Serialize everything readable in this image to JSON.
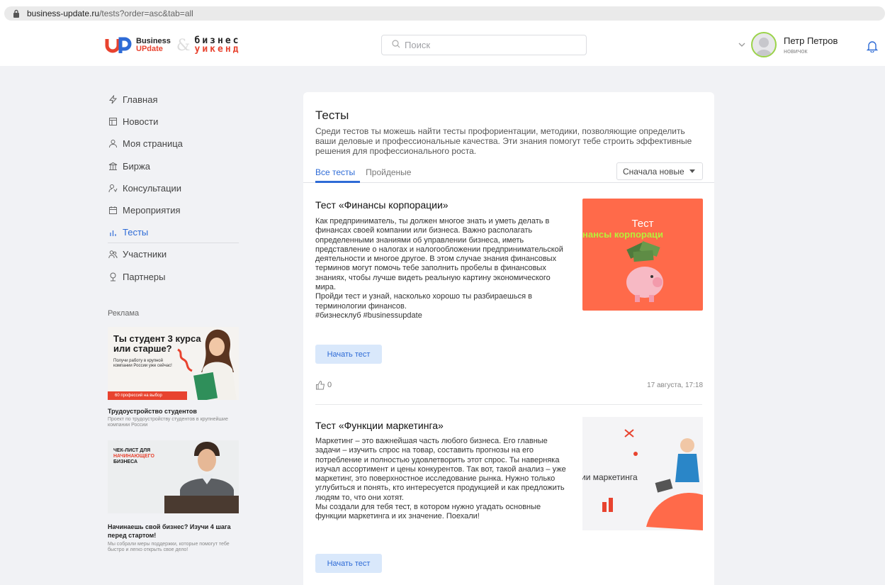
{
  "browser": {
    "url_host": "business-update.ru",
    "url_path": "/tests?order=asc&tab=all"
  },
  "header": {
    "logo": {
      "brand_top": "Business",
      "brand_bottom": "UPdate",
      "amp": "&",
      "word_top": "бизнес",
      "word_bottom": "уикенд"
    },
    "search": {
      "placeholder": "Поиск"
    },
    "user": {
      "name": "Петр Петров",
      "role": "новичок"
    }
  },
  "sidebar": {
    "items": [
      {
        "label": "Главная",
        "icon": "lightning-icon"
      },
      {
        "label": "Новости",
        "icon": "newspaper-icon"
      },
      {
        "label": "Моя страница",
        "icon": "user-icon"
      },
      {
        "label": "Биржа",
        "icon": "exchange-icon"
      },
      {
        "label": "Консультации",
        "icon": "consult-icon"
      },
      {
        "label": "Мероприятия",
        "icon": "calendar-icon"
      },
      {
        "label": "Тесты",
        "icon": "chart-icon",
        "active": true
      },
      {
        "label": "Участники",
        "icon": "users-icon"
      },
      {
        "label": "Партнеры",
        "icon": "partner-icon"
      }
    ],
    "ads_label": "Реклама",
    "ad1": {
      "headline": "Ты студент 3 курса или старше?",
      "sub": "Получи работу в крупной компании России уже сейчас!",
      "bar": "60 профессий на выбор",
      "title": "Трудоустройство студентов",
      "desc": "Проект по трудоустройству студентов в крупнейшие компании России"
    },
    "ad2": {
      "line1": "ЧЕК-ЛИСТ ДЛЯ",
      "line2": "НАЧИНАЮЩЕГО",
      "line3": "БИЗНЕСА",
      "title": "Начинаешь свой бизнес? Изучи 4 шага перед стартом!",
      "desc": "Мы собрали меры поддержки, которые помогут тебе быстро и легко открыть свое дело!"
    }
  },
  "main": {
    "title": "Тесты",
    "intro": "Среди тестов ты можешь найти тесты профориентации, методики, позволяющие определить ваши деловые и профессиональные качества. Эти знания помогут тебе строить эффективные решения для профессионального роста.",
    "tabs": [
      {
        "label": "Все тесты",
        "active": true
      },
      {
        "label": "Пройденые",
        "active": false
      }
    ],
    "sort": "Сначала новые",
    "tests": [
      {
        "title": "Тест «Финансы корпорации»",
        "description": "Как предприниматель, ты должен многое знать и уметь делать в финансах своей компании или бизнеса. Важно располагать определенными знаниями об управлении бизнеса, иметь представление о налогах и налогообложении предпринимательской деятельности и многое другое. В этом случае знания финансовых терминов могут помочь тебе заполнить пробелы в финансовых знаниях, чтобы лучше видеть реальную картину экономического мира.\nПройди тест и узнай, насколько хорошо ты разбираешься в терминологии финансов.\n#бизнесклуб #businessupdate",
        "button": "Начать тест",
        "likes": "0",
        "date": "17 августа, 17:18",
        "image_title": "Тест",
        "image_subtitle": "инансы корпораци"
      },
      {
        "title": "Тест «Функции маркетинга»",
        "description": "Маркетинг – это важнейшая часть любого бизнеса. Его главные задачи – изучить спрос на товар, составить прогнозы на его потребление и полностью удовлетворить этот спрос. Ты наверняка изучал ассортимент и цены конкурентов. Так вот, такой анализ – уже маркетинг, это поверхностное исследование рынка. Нужно только углубиться и понять, кто интересуется продукцией и как предложить людям то, что они хотят.\nМы создали для тебя тест, в котором нужно угадать основные функции маркетинга и их значение. Поехали!",
        "button": "Начать тест",
        "image_title": "ии маркетинга"
      }
    ]
  },
  "colors": {
    "accent": "#2e6bd6",
    "brand_red": "#e8432f",
    "avatar_ring": "#9bd34a"
  }
}
